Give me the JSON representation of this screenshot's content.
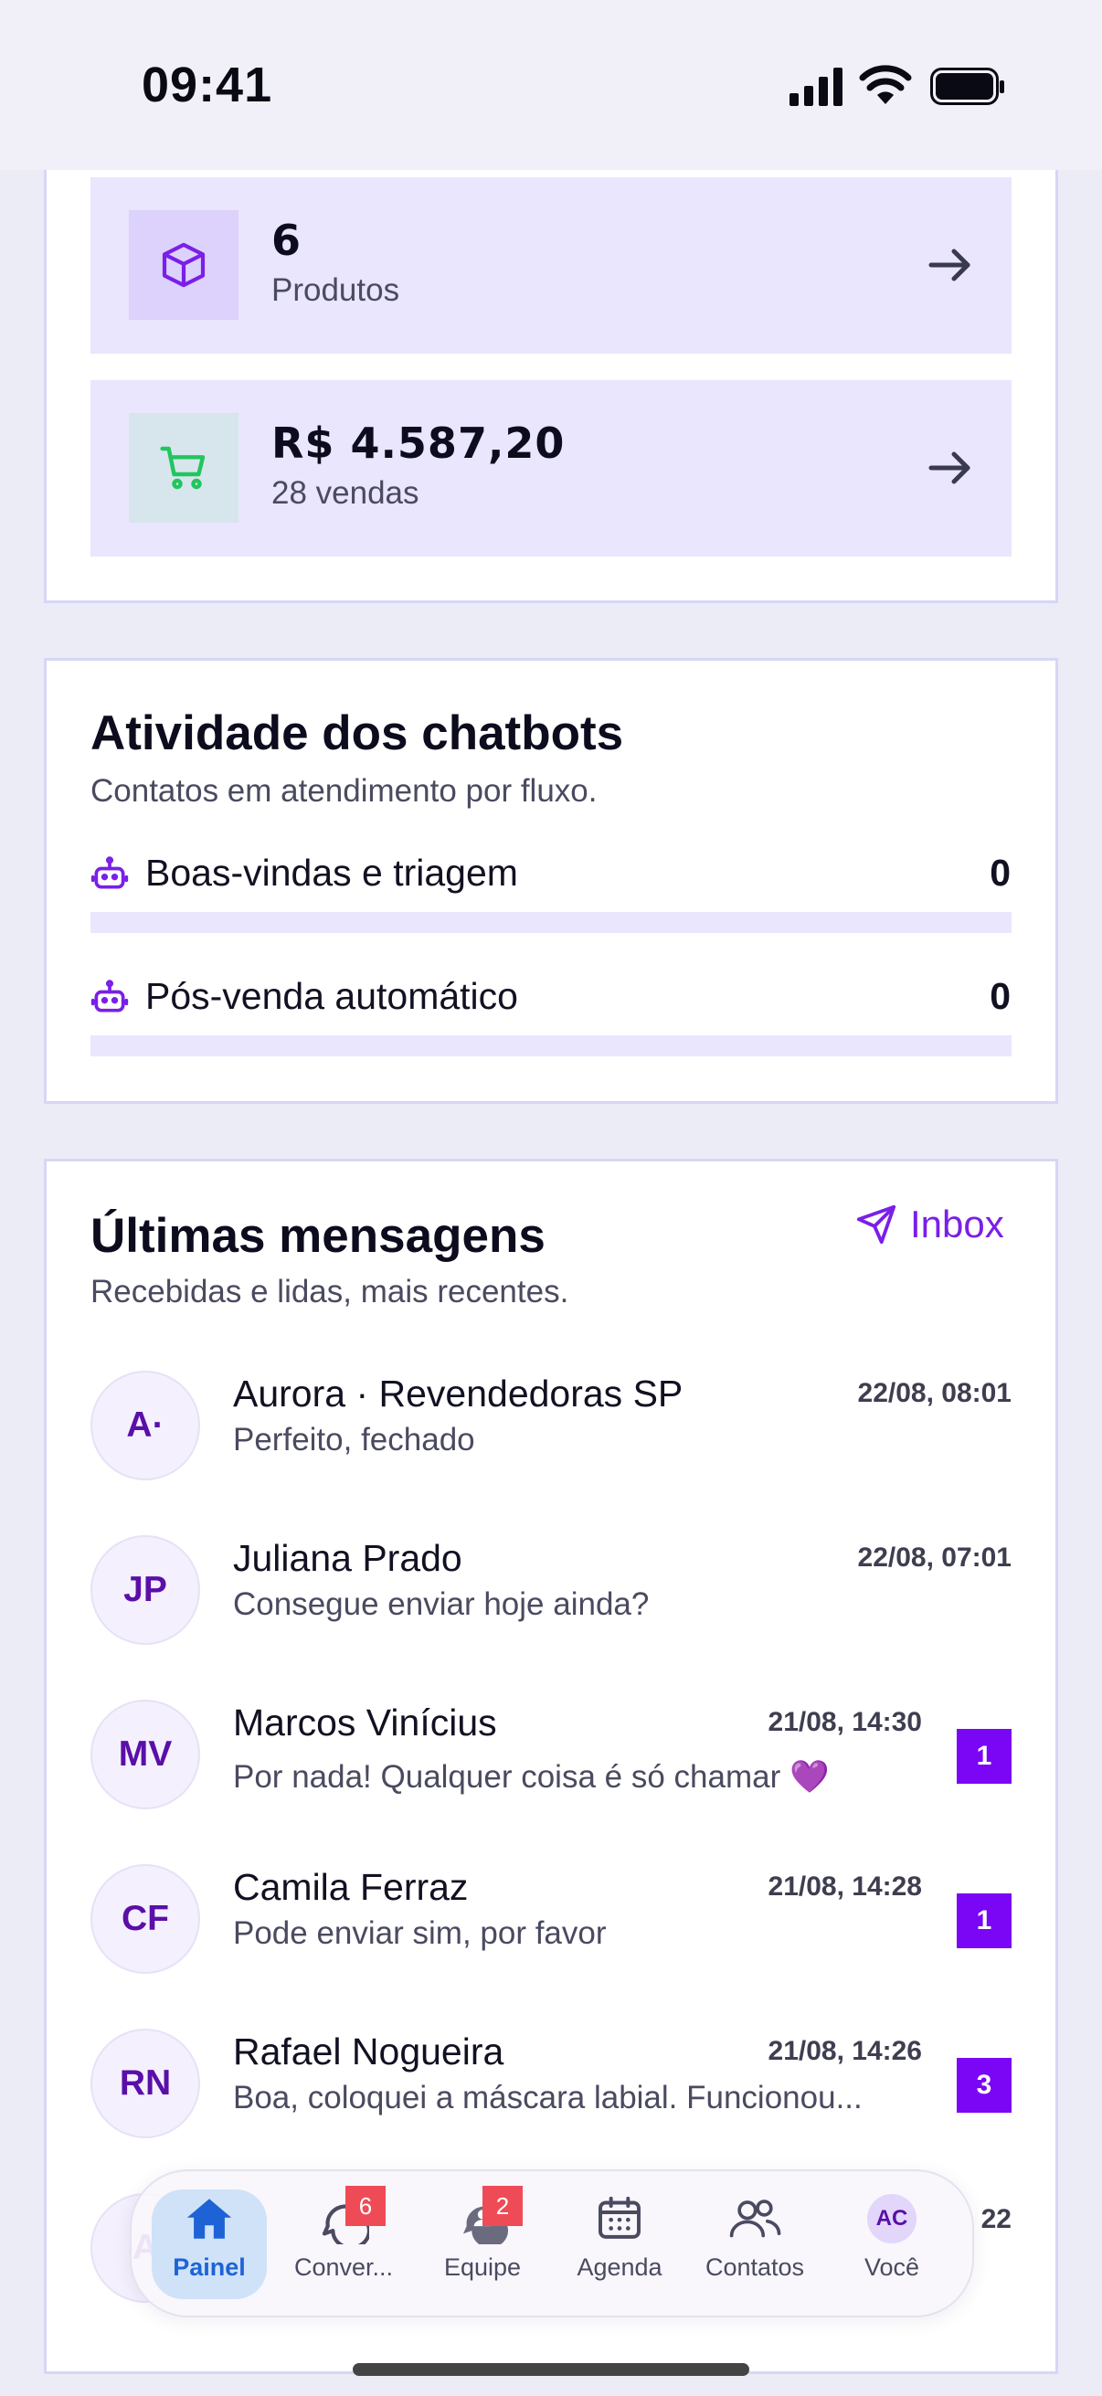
{
  "status_bar": {
    "time": "09:41"
  },
  "stats": [
    {
      "value": "6",
      "sub": "Produtos",
      "icon": "box-icon"
    },
    {
      "value": "R$ 4.587,20",
      "sub": "28 vendas",
      "icon": "cart-icon"
    }
  ],
  "chatbots": {
    "title": "Atividade dos chatbots",
    "subtitle": "Contatos em atendimento por fluxo.",
    "flows": [
      {
        "label": "Boas-vindas e triagem",
        "count": "0",
        "progress": 0
      },
      {
        "label": "Pós-venda automático",
        "count": "0",
        "progress": 0
      }
    ]
  },
  "messages": {
    "title": "Últimas mensagens",
    "subtitle": "Recebidas e lidas, mais recentes.",
    "inbox_label": "Inbox",
    "items": [
      {
        "initials": "A·",
        "name": "Aurora · Revendedoras SP",
        "preview": "Perfeito, fechado",
        "time": "22/08, 08:01",
        "badge": ""
      },
      {
        "initials": "JP",
        "name": "Juliana Prado",
        "preview": "Consegue enviar hoje ainda?",
        "time": "22/08, 07:01",
        "badge": ""
      },
      {
        "initials": "MV",
        "name": "Marcos Vinícius",
        "preview": "Por nada! Qualquer coisa é só chamar 💜",
        "time": "21/08, 14:30",
        "badge": "1"
      },
      {
        "initials": "CF",
        "name": "Camila Ferraz",
        "preview": "Pode enviar sim, por favor",
        "time": "21/08, 14:28",
        "badge": "1"
      },
      {
        "initials": "RN",
        "name": "Rafael Nogueira",
        "preview": "Boa, coloquei a máscara labial. Funcionou...",
        "time": "21/08, 14:26",
        "badge": "3"
      },
      {
        "initials": "A",
        "name": "",
        "preview": "",
        "time": "22",
        "badge": ""
      }
    ]
  },
  "tabbar": {
    "tabs": [
      {
        "label": "Painel",
        "active": true,
        "badge": ""
      },
      {
        "label": "Conver...",
        "active": false,
        "badge": "6"
      },
      {
        "label": "Equipe",
        "active": false,
        "badge": "2"
      },
      {
        "label": "Agenda",
        "active": false,
        "badge": ""
      },
      {
        "label": "Contatos",
        "active": false,
        "badge": ""
      },
      {
        "label": "Você",
        "active": false,
        "badge": "",
        "avatar_initials": "AC"
      }
    ]
  },
  "colors": {
    "accent": "#7a06f5",
    "tab_active": "#1e63d6",
    "badge_red": "#ef4b57"
  }
}
